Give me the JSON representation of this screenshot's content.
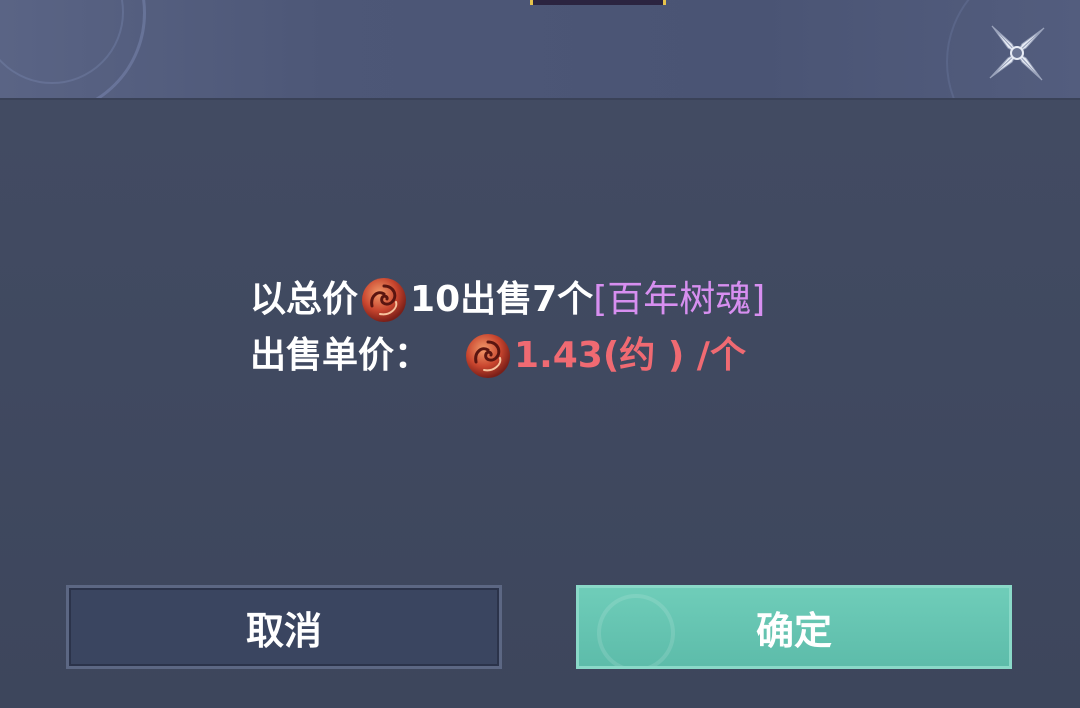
{
  "dialog": {
    "line1": {
      "prefix": "以总价",
      "total_price": "10",
      "middle": "出售7个",
      "item_name": "[百年树魂]"
    },
    "line2": {
      "prefix": "出售单价：",
      "unit_price": "1.43(约 ) /个"
    },
    "buttons": {
      "cancel_label": "取消",
      "confirm_label": "确定"
    },
    "currency_icon": "swirl-coin-icon",
    "close_icon": "shuriken-close-icon"
  },
  "colors": {
    "item_name": "#d78ff0",
    "unit_price": "#f06a72",
    "confirm_button": "#6fcdb9",
    "cancel_button": "#3a4560"
  }
}
